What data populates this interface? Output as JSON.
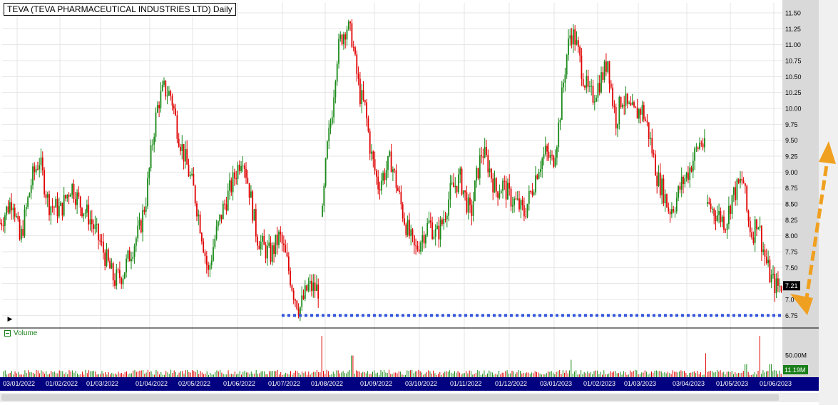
{
  "title": "TEVA (TEVA PHARMACEUTICAL INDUSTRIES LTD) Daily",
  "volume_label": "Volume",
  "colors": {
    "up": "#1a8a1a",
    "down": "#e00000",
    "grid": "#e4e4e4",
    "axis_panel": "#d9d9d9",
    "date_bar": "#000080",
    "support_line": "#3355dd",
    "arrow": "#f0a020",
    "price_badge": "#000000",
    "volume_badge": "#1a7f1a"
  },
  "chart_data": {
    "type": "candlestick",
    "price_axis": {
      "ticks": [
        "11.50",
        "11.25",
        "11.00",
        "10.75",
        "10.50",
        "10.25",
        "10.00",
        "9.75",
        "9.50",
        "9.25",
        "9.00",
        "8.75",
        "8.50",
        "8.25",
        "8.00",
        "7.75",
        "7.50",
        "7.25",
        "7.0",
        "6.75"
      ],
      "range": [
        6.6,
        11.6
      ]
    },
    "volume_axis": {
      "ticks": [
        "50.00M"
      ],
      "range": [
        0,
        110
      ]
    },
    "current_price": "7.21",
    "current_volume": "11.19M",
    "support_level": 6.75,
    "date_labels": [
      "03/01/2022",
      "01/02/2022",
      "01/03/2022",
      "01/04/2022",
      "02/05/2022",
      "01/06/2022",
      "01/07/2022",
      "01/08/2022",
      "01/09/2022",
      "03/10/2022",
      "01/11/2022",
      "01/12/2022",
      "03/01/2023",
      "01/02/2023",
      "01/03/2023",
      "03/04/2023",
      "01/05/2023",
      "01/06/2023"
    ],
    "price_path": [
      [
        0,
        8.2
      ],
      [
        18,
        8.6
      ],
      [
        28,
        7.9
      ],
      [
        45,
        8.9
      ],
      [
        55,
        9.2
      ],
      [
        68,
        8.5
      ],
      [
        85,
        8.4
      ],
      [
        100,
        8.8
      ],
      [
        112,
        8.5
      ],
      [
        125,
        8.3
      ],
      [
        140,
        7.9
      ],
      [
        160,
        7.3
      ],
      [
        172,
        7.4
      ],
      [
        185,
        7.8
      ],
      [
        196,
        8.1
      ],
      [
        205,
        8.6
      ],
      [
        215,
        9.6
      ],
      [
        222,
        10.1
      ],
      [
        230,
        10.3
      ],
      [
        240,
        10.2
      ],
      [
        250,
        9.6
      ],
      [
        262,
        9.1
      ],
      [
        272,
        8.7
      ],
      [
        282,
        8.1
      ],
      [
        292,
        7.4
      ],
      [
        300,
        7.9
      ],
      [
        312,
        8.4
      ],
      [
        325,
        8.8
      ],
      [
        340,
        9.3
      ],
      [
        350,
        8.7
      ],
      [
        360,
        8.0
      ],
      [
        370,
        7.8
      ],
      [
        380,
        7.7
      ],
      [
        392,
        8.0
      ],
      [
        402,
        7.6
      ],
      [
        412,
        7.1
      ],
      [
        420,
        6.85
      ],
      [
        432,
        7.2
      ],
      [
        448,
        7.15
      ]
    ],
    "price_path2": [
      [
        452,
        8.3
      ],
      [
        458,
        9.3
      ],
      [
        465,
        9.9
      ],
      [
        472,
        10.8
      ],
      [
        478,
        11.1
      ],
      [
        486,
        11.3
      ],
      [
        494,
        11.1
      ],
      [
        498,
        10.7
      ],
      [
        505,
        10.2
      ],
      [
        512,
        10.0
      ],
      [
        520,
        9.3
      ],
      [
        530,
        8.8
      ],
      [
        540,
        9.0
      ],
      [
        548,
        9.2
      ],
      [
        556,
        8.8
      ],
      [
        566,
        8.3
      ],
      [
        574,
        8.0
      ],
      [
        582,
        7.75
      ],
      [
        592,
        8.0
      ],
      [
        602,
        8.2
      ],
      [
        612,
        8.0
      ],
      [
        620,
        8.2
      ],
      [
        632,
        8.7
      ],
      [
        645,
        8.9
      ],
      [
        660,
        8.3
      ],
      [
        668,
        8.9
      ],
      [
        676,
        9.35
      ],
      [
        685,
        9.1
      ],
      [
        695,
        8.7
      ],
      [
        705,
        8.8
      ],
      [
        715,
        8.6
      ],
      [
        725,
        8.5
      ],
      [
        735,
        8.35
      ],
      [
        745,
        8.7
      ],
      [
        755,
        9.1
      ],
      [
        765,
        9.3
      ],
      [
        775,
        9.15
      ],
      [
        782,
        9.6
      ],
      [
        788,
        10.2
      ],
      [
        794,
        10.8
      ],
      [
        800,
        11.2
      ],
      [
        806,
        11.1
      ],
      [
        812,
        10.8
      ],
      [
        818,
        10.5
      ],
      [
        826,
        10.2
      ],
      [
        832,
        10.2
      ],
      [
        840,
        10.4
      ],
      [
        848,
        10.6
      ],
      [
        852,
        10.8
      ],
      [
        858,
        10.2
      ],
      [
        864,
        9.8
      ],
      [
        872,
        10.2
      ],
      [
        880,
        10.0
      ],
      [
        890,
        9.9
      ],
      [
        900,
        10.0
      ],
      [
        908,
        9.7
      ],
      [
        915,
        9.3
      ],
      [
        922,
        8.9
      ],
      [
        930,
        8.7
      ],
      [
        938,
        8.4
      ],
      [
        946,
        8.5
      ],
      [
        955,
        8.8
      ],
      [
        965,
        9.0
      ],
      [
        975,
        9.3
      ],
      [
        983,
        9.5
      ],
      [
        990,
        9.3
      ]
    ],
    "price_path3": [
      [
        992,
        8.5
      ],
      [
        1000,
        8.4
      ],
      [
        1010,
        8.3
      ],
      [
        1018,
        8.2
      ],
      [
        1026,
        8.6
      ],
      [
        1034,
        8.75
      ],
      [
        1042,
        8.9
      ],
      [
        1048,
        8.3
      ],
      [
        1055,
        8.0
      ],
      [
        1062,
        8.3
      ],
      [
        1068,
        7.9
      ],
      [
        1074,
        7.6
      ],
      [
        1080,
        7.35
      ],
      [
        1088,
        7.2
      ],
      [
        1096,
        7.21
      ]
    ],
    "volume_spikes": [
      [
        452,
        95
      ],
      [
        494,
        50
      ],
      [
        800,
        40
      ],
      [
        990,
        55
      ],
      [
        1046,
        30
      ],
      [
        1066,
        95
      ],
      [
        1080,
        30
      ]
    ]
  }
}
